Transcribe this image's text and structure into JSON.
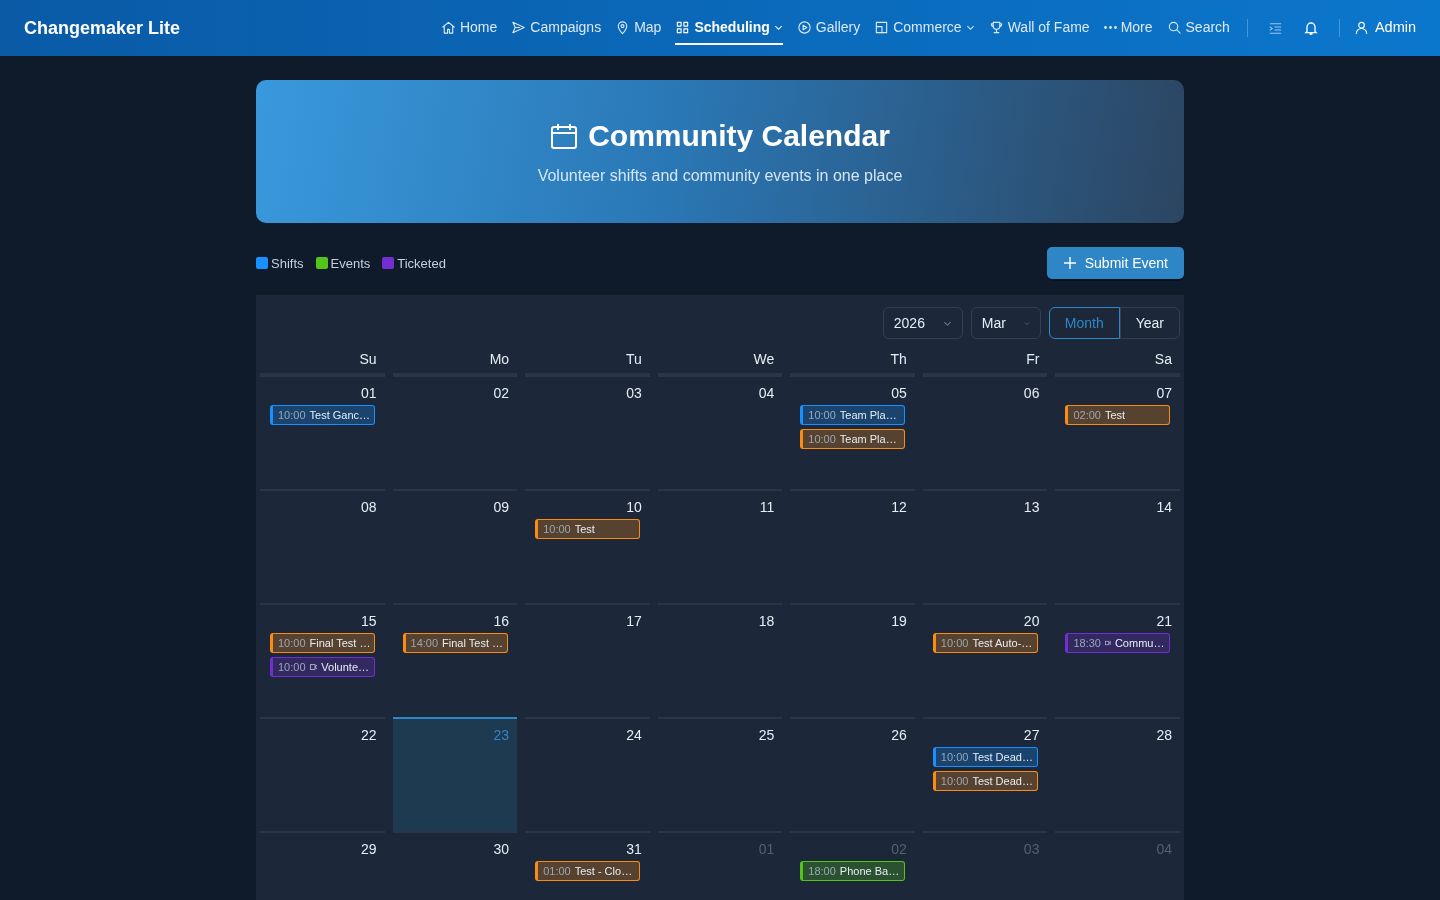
{
  "app": {
    "title": "Changemaker Lite"
  },
  "nav": [
    {
      "label": "Home",
      "selected": false,
      "dropdown": false
    },
    {
      "label": "Campaigns",
      "selected": false,
      "dropdown": false
    },
    {
      "label": "Map",
      "selected": false,
      "dropdown": false
    },
    {
      "label": "Scheduling",
      "selected": true,
      "dropdown": true
    },
    {
      "label": "Gallery",
      "selected": false,
      "dropdown": false
    },
    {
      "label": "Commerce",
      "selected": false,
      "dropdown": true
    },
    {
      "label": "Wall of Fame",
      "selected": false,
      "dropdown": false
    },
    {
      "label": "More",
      "selected": false,
      "dropdown": false
    },
    {
      "label": "Search",
      "selected": false,
      "dropdown": false
    }
  ],
  "user": {
    "label": "Admin"
  },
  "hero": {
    "title": "Community Calendar",
    "subtitle": "Volunteer shifts and community events in one place"
  },
  "legend": [
    {
      "label": "Shifts",
      "color": "#1890ff"
    },
    {
      "label": "Events",
      "color": "#52c41a"
    },
    {
      "label": "Ticketed",
      "color": "#722ed1"
    }
  ],
  "submit_button": "Submit Event",
  "controls": {
    "year": "2026",
    "month": "Mar",
    "views": [
      {
        "label": "Month",
        "selected": true
      },
      {
        "label": "Year",
        "selected": false
      }
    ]
  },
  "weekdays": [
    "Su",
    "Mo",
    "Tu",
    "We",
    "Th",
    "Fr",
    "Sa"
  ],
  "weeks": [
    [
      {
        "day": "01",
        "other_month": false,
        "today": false,
        "events": [
          {
            "time": "10:00",
            "title": "Test Ganc…",
            "color": "#1890ff",
            "kind": "standard"
          }
        ]
      },
      {
        "day": "02",
        "other_month": false,
        "today": false
      },
      {
        "day": "03",
        "other_month": false,
        "today": false
      },
      {
        "day": "04",
        "other_month": false,
        "today": false
      },
      {
        "day": "05",
        "other_month": false,
        "today": false,
        "events": [
          {
            "time": "10:00",
            "title": "Team Pla…",
            "color": "#1890ff",
            "kind": "standard"
          },
          {
            "time": "10:00",
            "title": "Team Pla…",
            "color": "#fa8c16",
            "kind": "standard"
          }
        ]
      },
      {
        "day": "06",
        "other_month": false,
        "today": false
      },
      {
        "day": "07",
        "other_month": false,
        "today": false,
        "events": [
          {
            "time": "02:00",
            "title": "Test",
            "color": "#fa8c16",
            "kind": "standard"
          }
        ]
      }
    ],
    [
      {
        "day": "08",
        "other_month": false,
        "today": false
      },
      {
        "day": "09",
        "other_month": false,
        "today": false
      },
      {
        "day": "10",
        "other_month": false,
        "today": false,
        "events": [
          {
            "time": "10:00",
            "title": "Test",
            "color": "#fa8c16",
            "kind": "standard"
          }
        ]
      },
      {
        "day": "11",
        "other_month": false,
        "today": false
      },
      {
        "day": "12",
        "other_month": false,
        "today": false
      },
      {
        "day": "13",
        "other_month": false,
        "today": false
      },
      {
        "day": "14",
        "other_month": false,
        "today": false
      }
    ],
    [
      {
        "day": "15",
        "other_month": false,
        "today": false,
        "events": [
          {
            "time": "10:00",
            "title": "Final Test …",
            "color": "#fa8c16",
            "kind": "standard"
          },
          {
            "time": "10:00",
            "title": "Volunte…",
            "color": "#722ed1",
            "kind": "online"
          }
        ]
      },
      {
        "day": "16",
        "other_month": false,
        "today": false,
        "events": [
          {
            "time": "14:00",
            "title": "Final Test …",
            "color": "#fa8c16",
            "kind": "standard"
          }
        ]
      },
      {
        "day": "17",
        "other_month": false,
        "today": false
      },
      {
        "day": "18",
        "other_month": false,
        "today": false
      },
      {
        "day": "19",
        "other_month": false,
        "today": false
      },
      {
        "day": "20",
        "other_month": false,
        "today": false,
        "events": [
          {
            "time": "10:00",
            "title": "Test Auto-…",
            "color": "#fa8c16",
            "kind": "standard"
          }
        ]
      },
      {
        "day": "21",
        "other_month": false,
        "today": false,
        "events": [
          {
            "time": "18:30",
            "title": "Commu…",
            "color": "#722ed1",
            "kind": "online"
          }
        ]
      }
    ],
    [
      {
        "day": "22",
        "other_month": false,
        "today": false
      },
      {
        "day": "23",
        "other_month": false,
        "today": true
      },
      {
        "day": "24",
        "other_month": false,
        "today": false
      },
      {
        "day": "25",
        "other_month": false,
        "today": false
      },
      {
        "day": "26",
        "other_month": false,
        "today": false
      },
      {
        "day": "27",
        "other_month": false,
        "today": false,
        "events": [
          {
            "time": "10:00",
            "title": "Test Dead…",
            "color": "#1890ff",
            "kind": "standard"
          },
          {
            "time": "10:00",
            "title": "Test Dead…",
            "color": "#fa8c16",
            "kind": "standard"
          }
        ]
      },
      {
        "day": "28",
        "other_month": false,
        "today": false
      }
    ],
    [
      {
        "day": "29",
        "other_month": false,
        "today": false
      },
      {
        "day": "30",
        "other_month": false,
        "today": false
      },
      {
        "day": "31",
        "other_month": false,
        "today": false,
        "events": [
          {
            "time": "01:00",
            "title": "Test - Clo…",
            "color": "#fa8c16",
            "kind": "standard"
          }
        ]
      },
      {
        "day": "01",
        "other_month": true,
        "today": false
      },
      {
        "day": "02",
        "other_month": true,
        "today": false,
        "events": [
          {
            "time": "18:00",
            "title": "Phone Ba…",
            "color": "#52c41a",
            "kind": "standard"
          }
        ]
      },
      {
        "day": "03",
        "other_month": true,
        "today": false
      },
      {
        "day": "04",
        "other_month": true,
        "today": false
      }
    ]
  ]
}
